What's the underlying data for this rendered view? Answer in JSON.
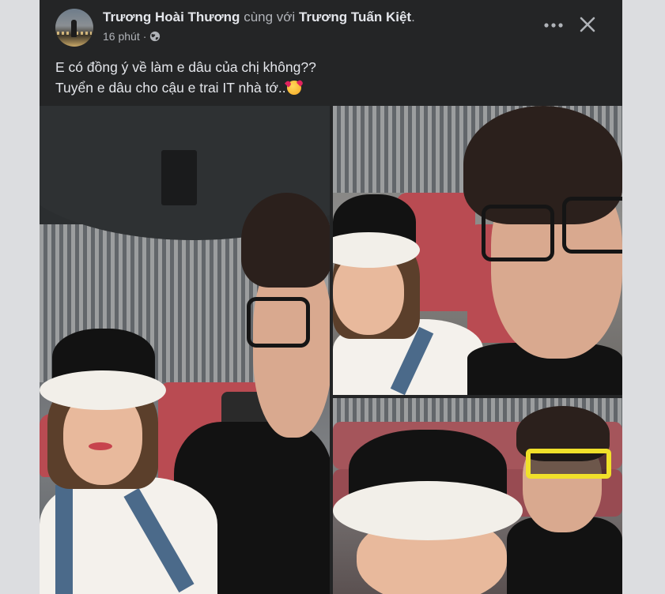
{
  "post": {
    "author": "Trương Hoài Thương",
    "with_text": "cùng với",
    "tagged": "Trương Tuấn Kiệt",
    "tagged_suffix": ".",
    "time": "16 phút",
    "separator": "·",
    "privacy_icon": "globe-icon",
    "caption_line1": "E có đồng ý về làm e dâu của chị không??",
    "caption_line2": "Tuyển e dâu cho cậu e trai IT nhà tớ..",
    "caption_emoji": "smiling-face-with-hearts",
    "more_icon": "more-horizontal-icon",
    "close_icon": "close-icon"
  },
  "colors": {
    "card_bg": "#242526",
    "page_bg": "#dcdde0",
    "text_primary": "#e4e6eb",
    "text_secondary": "#b0b3b8"
  },
  "photos": [
    {
      "name": "photo-1",
      "description": "cinema selfie"
    },
    {
      "name": "photo-2",
      "description": "cinema selfie close-up"
    },
    {
      "name": "photo-3",
      "description": "3d glasses selfie"
    }
  ]
}
